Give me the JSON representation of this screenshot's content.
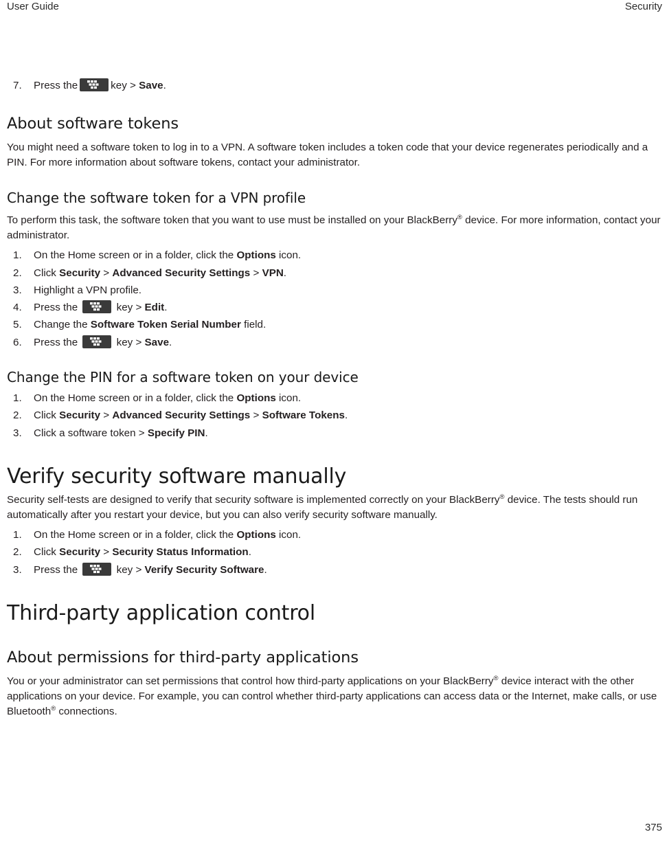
{
  "header": {
    "left": "User Guide",
    "right": "Security"
  },
  "footer": {
    "page_number": "375"
  },
  "icons": {
    "menu_key": "blackberry-menu-key-icon"
  },
  "blocks": {
    "step7": {
      "number": "7.",
      "text_before": "Press the",
      "text_middle": "key >",
      "bold": "Save",
      "text_after": "."
    },
    "about_software_tokens": {
      "heading": "About software tokens",
      "paragraph": "You might need a software token to log in to a VPN. A software token includes a token code that your device regenerates periodically and a PIN. For more information about software tokens, contact your administrator."
    },
    "change_token_vpn": {
      "heading": "Change the software token for a VPN profile",
      "paragraph_part1": "To perform this task, the software token that you want to use must be installed on your BlackBerry",
      "paragraph_part2": " device. For more information, contact your administrator.",
      "steps": [
        {
          "number": "1.",
          "segments": [
            {
              "type": "text",
              "value": "On the Home screen or in a folder, click the "
            },
            {
              "type": "bold",
              "value": "Options"
            },
            {
              "type": "text",
              "value": " icon."
            }
          ]
        },
        {
          "number": "2.",
          "segments": [
            {
              "type": "text",
              "value": "Click "
            },
            {
              "type": "bold",
              "value": "Security"
            },
            {
              "type": "text",
              "value": " > "
            },
            {
              "type": "bold",
              "value": "Advanced Security Settings"
            },
            {
              "type": "text",
              "value": " > "
            },
            {
              "type": "bold",
              "value": "VPN"
            },
            {
              "type": "text",
              "value": "."
            }
          ]
        },
        {
          "number": "3.",
          "segments": [
            {
              "type": "text",
              "value": "Highlight a VPN profile."
            }
          ]
        },
        {
          "number": "4.",
          "segments": [
            {
              "type": "text",
              "value": "Press the "
            },
            {
              "type": "icon",
              "value": "blackberry-menu-key-icon"
            },
            {
              "type": "text",
              "value": " key > "
            },
            {
              "type": "bold",
              "value": "Edit"
            },
            {
              "type": "text",
              "value": "."
            }
          ]
        },
        {
          "number": "5.",
          "segments": [
            {
              "type": "text",
              "value": "Change the "
            },
            {
              "type": "bold",
              "value": "Software Token Serial Number"
            },
            {
              "type": "text",
              "value": " field."
            }
          ]
        },
        {
          "number": "6.",
          "segments": [
            {
              "type": "text",
              "value": "Press the "
            },
            {
              "type": "icon",
              "value": "blackberry-menu-key-icon"
            },
            {
              "type": "text",
              "value": " key > "
            },
            {
              "type": "bold",
              "value": "Save"
            },
            {
              "type": "text",
              "value": "."
            }
          ]
        }
      ]
    },
    "change_pin_token": {
      "heading": "Change the PIN for a software token on your device",
      "steps": [
        {
          "number": "1.",
          "segments": [
            {
              "type": "text",
              "value": "On the Home screen or in a folder, click the "
            },
            {
              "type": "bold",
              "value": "Options"
            },
            {
              "type": "text",
              "value": " icon."
            }
          ]
        },
        {
          "number": "2.",
          "segments": [
            {
              "type": "text",
              "value": "Click "
            },
            {
              "type": "bold",
              "value": "Security"
            },
            {
              "type": "text",
              "value": " > "
            },
            {
              "type": "bold",
              "value": "Advanced Security Settings"
            },
            {
              "type": "text",
              "value": " > "
            },
            {
              "type": "bold",
              "value": "Software Tokens"
            },
            {
              "type": "text",
              "value": "."
            }
          ]
        },
        {
          "number": "3.",
          "segments": [
            {
              "type": "text",
              "value": "Click a software token > "
            },
            {
              "type": "bold",
              "value": "Specify PIN"
            },
            {
              "type": "text",
              "value": "."
            }
          ]
        }
      ]
    },
    "verify_security_software": {
      "heading": "Verify security software manually",
      "paragraph_part1": "Security self-tests are designed to verify that security software is implemented correctly on your BlackBerry",
      "paragraph_part2": " device. The tests should run automatically after you restart your device, but you can also verify security software manually.",
      "steps": [
        {
          "number": "1.",
          "segments": [
            {
              "type": "text",
              "value": "On the Home screen or in a folder, click the "
            },
            {
              "type": "bold",
              "value": "Options"
            },
            {
              "type": "text",
              "value": " icon."
            }
          ]
        },
        {
          "number": "2.",
          "segments": [
            {
              "type": "text",
              "value": "Click "
            },
            {
              "type": "bold",
              "value": "Security"
            },
            {
              "type": "text",
              "value": " > "
            },
            {
              "type": "bold",
              "value": "Security Status Information"
            },
            {
              "type": "text",
              "value": "."
            }
          ]
        },
        {
          "number": "3.",
          "segments": [
            {
              "type": "text",
              "value": "Press the "
            },
            {
              "type": "icon",
              "value": "blackberry-menu-key-icon"
            },
            {
              "type": "text",
              "value": " key > "
            },
            {
              "type": "bold",
              "value": "Verify Security Software"
            },
            {
              "type": "text",
              "value": "."
            }
          ]
        }
      ]
    },
    "third_party_control": {
      "heading": "Third-party application control"
    },
    "about_permissions": {
      "heading": "About permissions for third-party applications",
      "paragraph_part1": "You or your administrator can set permissions that control how third-party applications on your BlackBerry",
      "paragraph_part2": " device interact with the other applications on your device. For example, you can control whether third-party applications can access data or the Internet, make calls, or use Bluetooth",
      "paragraph_part3": " connections."
    }
  },
  "symbols": {
    "registered": "®"
  }
}
